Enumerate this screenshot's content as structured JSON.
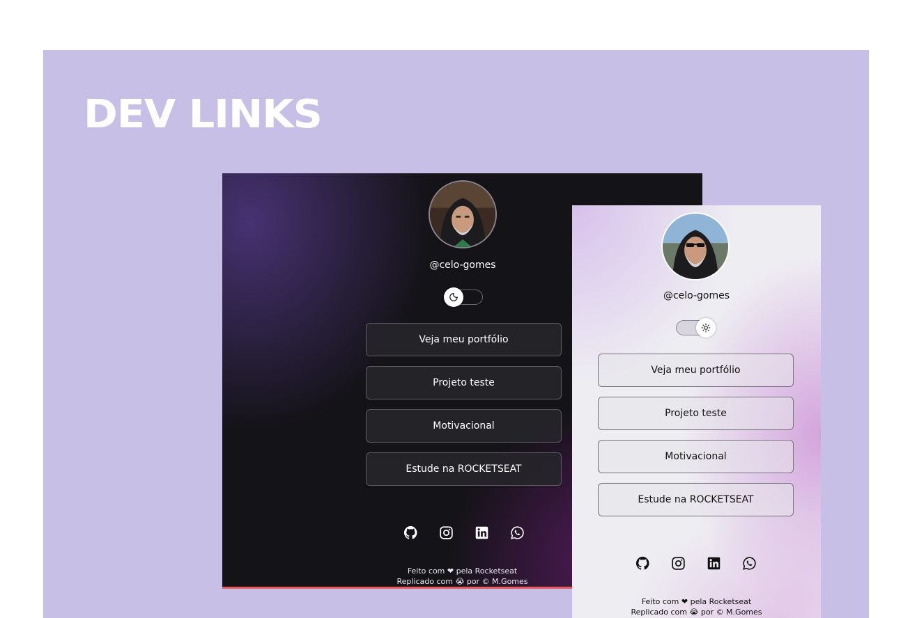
{
  "brand": "DEV LINKS",
  "dark_preview": {
    "theme": "dark",
    "handle": "@celo-gomes",
    "toggle_icon": "moon-icon",
    "links": [
      "Veja meu portfólio",
      "Projeto teste",
      "Motivacional",
      "Estude na ROCKETSEAT"
    ],
    "socials": [
      "github-icon",
      "instagram-icon",
      "linkedin-icon",
      "whatsapp-icon"
    ],
    "footer_line1": "Feito com ❤ pela Rocketseat",
    "footer_line2": "Replicado com 😭 por © M.Gomes"
  },
  "light_preview": {
    "theme": "light",
    "handle": "@celo-gomes",
    "toggle_icon": "sun-icon",
    "links": [
      "Veja meu portfólio",
      "Projeto teste",
      "Motivacional",
      "Estude na ROCKETSEAT"
    ],
    "socials": [
      "github-icon",
      "instagram-icon",
      "linkedin-icon",
      "whatsapp-icon"
    ],
    "footer_line1": "Feito com ❤ pela Rocketseat",
    "footer_line2": "Replicado com 😭 por © M.Gomes"
  },
  "colors": {
    "banner_bg": "#c7bfe6",
    "dark_bg": "#141317",
    "dark_accent": "#e65b5b",
    "light_bg": "#eeeef2"
  }
}
